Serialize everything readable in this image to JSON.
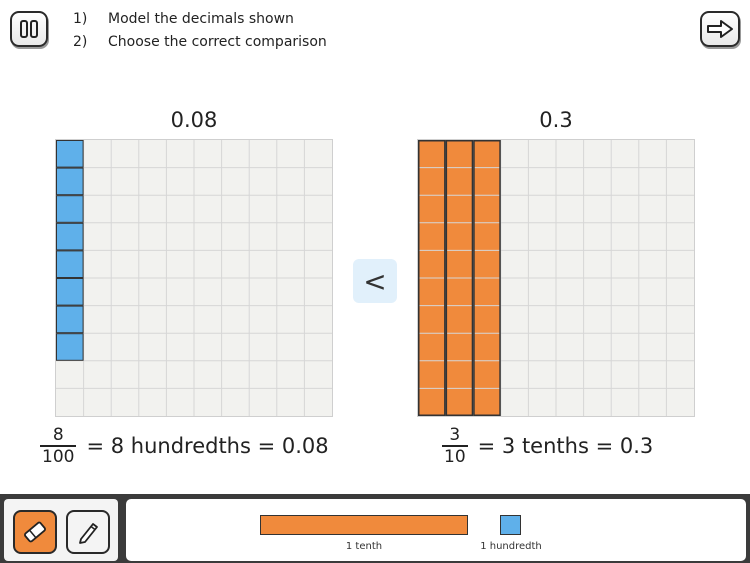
{
  "header": {
    "instructions": [
      {
        "num": "1)",
        "text": "Model the decimals shown"
      },
      {
        "num": "2)",
        "text": "Choose the correct comparison"
      }
    ],
    "pause_icon": "pause-icon",
    "next_icon": "arrow-right-icon"
  },
  "left_model": {
    "title": "0.08",
    "shaded_hundredths": 8,
    "shaded_tenths": 0,
    "equation": {
      "numerator": "8",
      "denominator": "100",
      "text": "= 8 hundredths = 0.08"
    }
  },
  "right_model": {
    "title": "0.3",
    "shaded_hundredths": 0,
    "shaded_tenths": 3,
    "equation": {
      "numerator": "3",
      "denominator": "10",
      "text": "= 3 tenths = 0.3"
    }
  },
  "comparison": {
    "symbol": "<"
  },
  "toolbar": {
    "eraser_icon": "eraser-icon",
    "pen_icon": "pen-icon",
    "legend": {
      "tenth_label": "1 tenth",
      "hundredth_label": "1 hundredth"
    }
  },
  "colors": {
    "tenth": "#f08a3c",
    "hundredth": "#5fb0ea",
    "grid_bg": "#f2f2ef",
    "grid_line": "#d6d6d6",
    "compare_bg": "#e1f0fb",
    "bottom_bar": "#3b3b3b"
  }
}
